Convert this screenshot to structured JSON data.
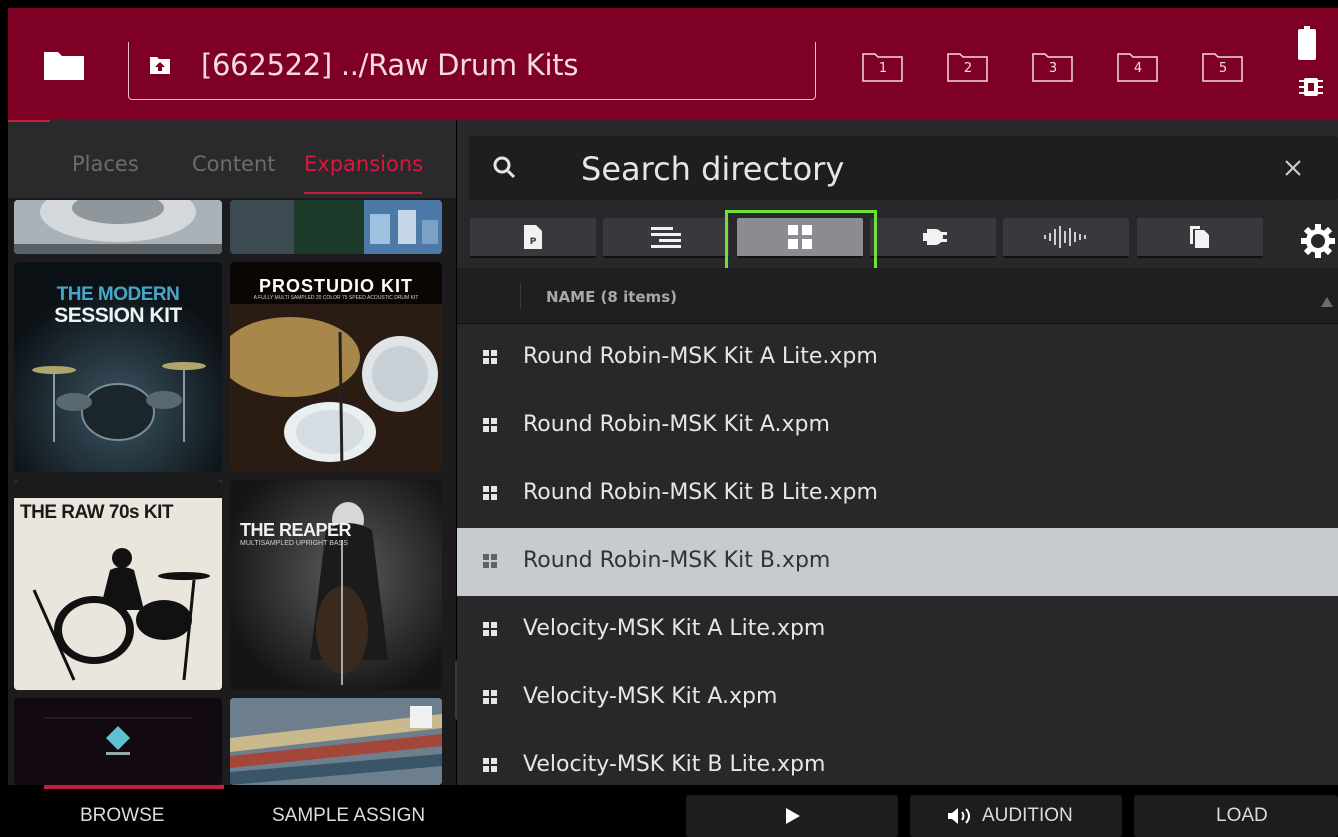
{
  "header": {
    "path": "[662522] ../Raw Drum Kits",
    "favorites": [
      "1",
      "2",
      "3",
      "4",
      "5"
    ]
  },
  "left": {
    "tabs": [
      "Places",
      "Content",
      "Expansions"
    ],
    "active_tab": "Expansions",
    "tiles": {
      "modern_session": [
        "THE MODERN",
        "SESSION KIT"
      ],
      "pro_studio": [
        "PROSTUDIO KIT",
        "A FULLY MULTI SAMPLED 20 COLOR 75 SPEED ACOUSTIC DRUM KIT"
      ],
      "raw70s": "THE RAW 70s KIT",
      "reaper": [
        "THE REAPER",
        "MULTISAMPLED UPRIGHT BASS"
      ]
    }
  },
  "search": {
    "placeholder": "Search directory",
    "clear_icon": "close-icon"
  },
  "filters": {
    "icons": [
      "program-icon",
      "sequence-icon",
      "grid-icon",
      "plugin-icon",
      "waveform-icon",
      "copy-icon"
    ],
    "active": "grid-icon"
  },
  "list": {
    "header": "NAME (8 items)",
    "selected_index": 3,
    "items": [
      "Round Robin-MSK Kit A Lite.xpm",
      "Round Robin-MSK Kit A.xpm",
      "Round Robin-MSK Kit B Lite.xpm",
      "Round Robin-MSK Kit B.xpm",
      "Velocity-MSK Kit A Lite.xpm",
      "Velocity-MSK Kit A.xpm",
      "Velocity-MSK Kit B Lite.xpm"
    ]
  },
  "bottom": {
    "browse": "BROWSE",
    "sample_assign": "SAMPLE ASSIGN",
    "audition": "AUDITION",
    "load": "LOAD"
  },
  "colors": {
    "brand": "#7e0024",
    "accent": "#c41e3a",
    "selection": "#c6cbd0",
    "focus": "#71e03a"
  }
}
